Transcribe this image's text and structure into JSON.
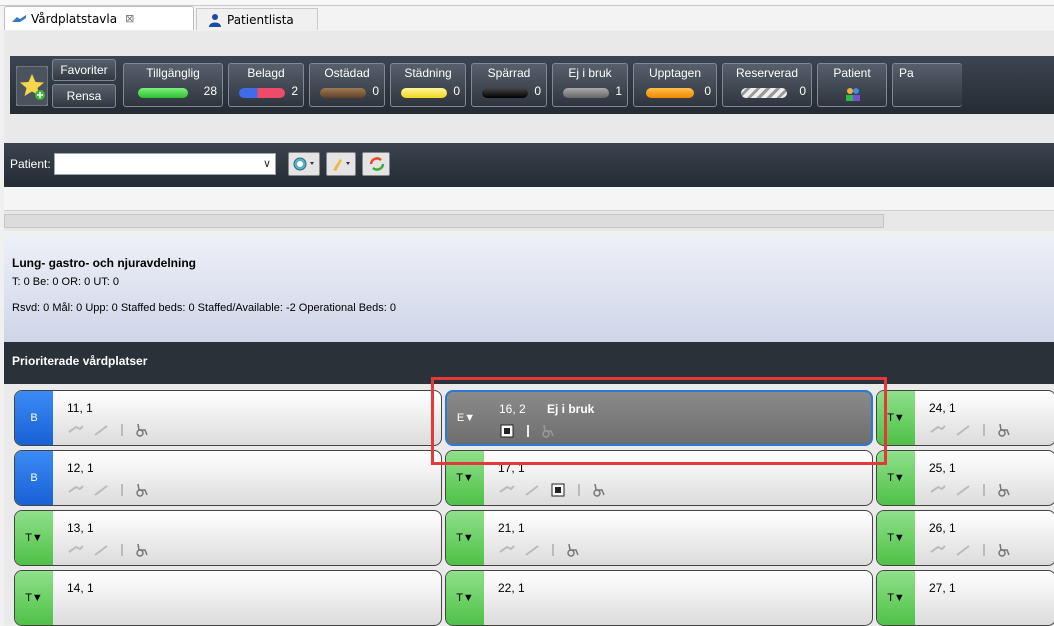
{
  "tabs": [
    {
      "label": "Vårdplatstavla",
      "close": "⊠",
      "active": true
    },
    {
      "label": "Patientlista",
      "active": false
    }
  ],
  "toolbar": {
    "favoriter_label": "Favoriter",
    "rensa_label": "Rensa",
    "statuses": [
      {
        "label": "Tillgänglig",
        "count": "28",
        "color": "#3fcf3f"
      },
      {
        "label": "Belagd",
        "count": "2",
        "color": "#e84a6b"
      },
      {
        "label": "Ostädad",
        "count": "0",
        "color": "#7a5a3a"
      },
      {
        "label": "Städning",
        "count": "0",
        "color": "#f5e44a"
      },
      {
        "label": "Spärrad",
        "count": "0",
        "color": "#111111"
      },
      {
        "label": "Ej i bruk",
        "count": "1",
        "color": "#777777"
      },
      {
        "label": "Upptagen",
        "count": "0",
        "color": "#f59a14"
      },
      {
        "label": "Reserverad",
        "count": "0",
        "color": "#cfcfcf"
      },
      {
        "label": "Patient",
        "count": "",
        "color": ""
      },
      {
        "label": "Pa",
        "count": "",
        "color": ""
      }
    ]
  },
  "patient_bar": {
    "label": "Patient:",
    "value": ""
  },
  "department": {
    "title": "Lung- gastro- och njuravdelning",
    "line1": "T: 0 Be: 0 OR: 0 UT: 0",
    "line2": "Rsvd: 0 Mål: 0 Upp: 0 Staffed beds: 0 Staffed/Available: -2 Operational Beds: 0"
  },
  "priority_header": "Prioriterade vårdplatser",
  "beds": [
    {
      "id": "11, 1",
      "badge": "B",
      "status": ""
    },
    {
      "id": "16, 2",
      "badge": "E▼",
      "status": "Ej i bruk"
    },
    {
      "id": "24, 1",
      "badge": "T▼",
      "status": ""
    },
    {
      "id": "12, 1",
      "badge": "B",
      "status": ""
    },
    {
      "id": "17, 1",
      "badge": "T▼",
      "status": ""
    },
    {
      "id": "25, 1",
      "badge": "T▼",
      "status": ""
    },
    {
      "id": "13, 1",
      "badge": "T▼",
      "status": ""
    },
    {
      "id": "21, 1",
      "badge": "T▼",
      "status": ""
    },
    {
      "id": "26, 1",
      "badge": "T▼",
      "status": ""
    },
    {
      "id": "14, 1",
      "badge": "T▼",
      "status": ""
    },
    {
      "id": "22, 1",
      "badge": "T▼",
      "status": ""
    },
    {
      "id": "27, 1",
      "badge": "T▼",
      "status": ""
    }
  ]
}
